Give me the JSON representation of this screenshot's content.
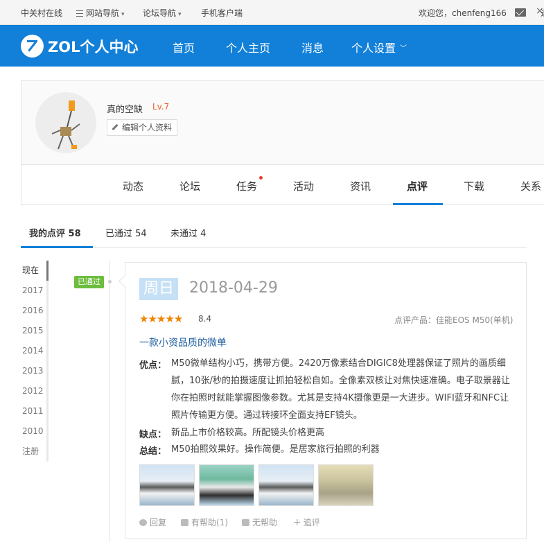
{
  "topbar": {
    "site": "中关村在线",
    "site_nav": "网站导航",
    "forum_nav": "论坛导航",
    "mobile": "手机客户端",
    "welcome": "欢迎您，chenfeng166",
    "cut_char": "退"
  },
  "header": {
    "logo": "ZOL个人中心",
    "nav": [
      "首页",
      "个人主页",
      "消息",
      "个人设置"
    ]
  },
  "profile": {
    "username": "真的空缺",
    "level": "Lv.7",
    "edit_label": "编辑个人资料",
    "tabs": [
      "动态",
      "论坛",
      "任务",
      "活动",
      "资讯",
      "点评",
      "下载",
      "关系"
    ],
    "active_tab": "点评"
  },
  "subtabs": {
    "mine": "我的点评 58",
    "passed": "已通过 54",
    "not_passed": "未通过 4"
  },
  "years": [
    "现在",
    "2017",
    "2016",
    "2015",
    "2014",
    "2013",
    "2012",
    "2011",
    "2010",
    "注册"
  ],
  "review": {
    "status": "已通过",
    "weekday": "周日",
    "date": "2018-04-29",
    "stars": 5,
    "score": "8.4",
    "product": "点评产品：佳能EOS M50(单机)",
    "title": "一款小资品质的微单",
    "pros_label": "优点：",
    "pros": "M50微单结构小巧，携带方便。2420万像素结合DIGIC8处理器保证了照片的画质细腻，10张/秒的拍摄速度让抓拍轻松自如。全像素双核让对焦快速准确。电子取景器让你在拍照时就能掌握图像参数。尤其是支持4K摄像更是一大进步。WIFI蓝牙和NFC让照片传输更方便。通过转接环全面支持EF镜头。",
    "cons_label": "缺点：",
    "cons": "新品上市价格较高。所配镜头价格更高",
    "summary_label": "总结：",
    "summary": "M50拍照效果好。操作简便。是居家旅行拍照的利器",
    "actions": {
      "reply": "回复",
      "helpful": "有帮助(1)",
      "unhelpful": "无帮助",
      "followup": "追评"
    }
  }
}
